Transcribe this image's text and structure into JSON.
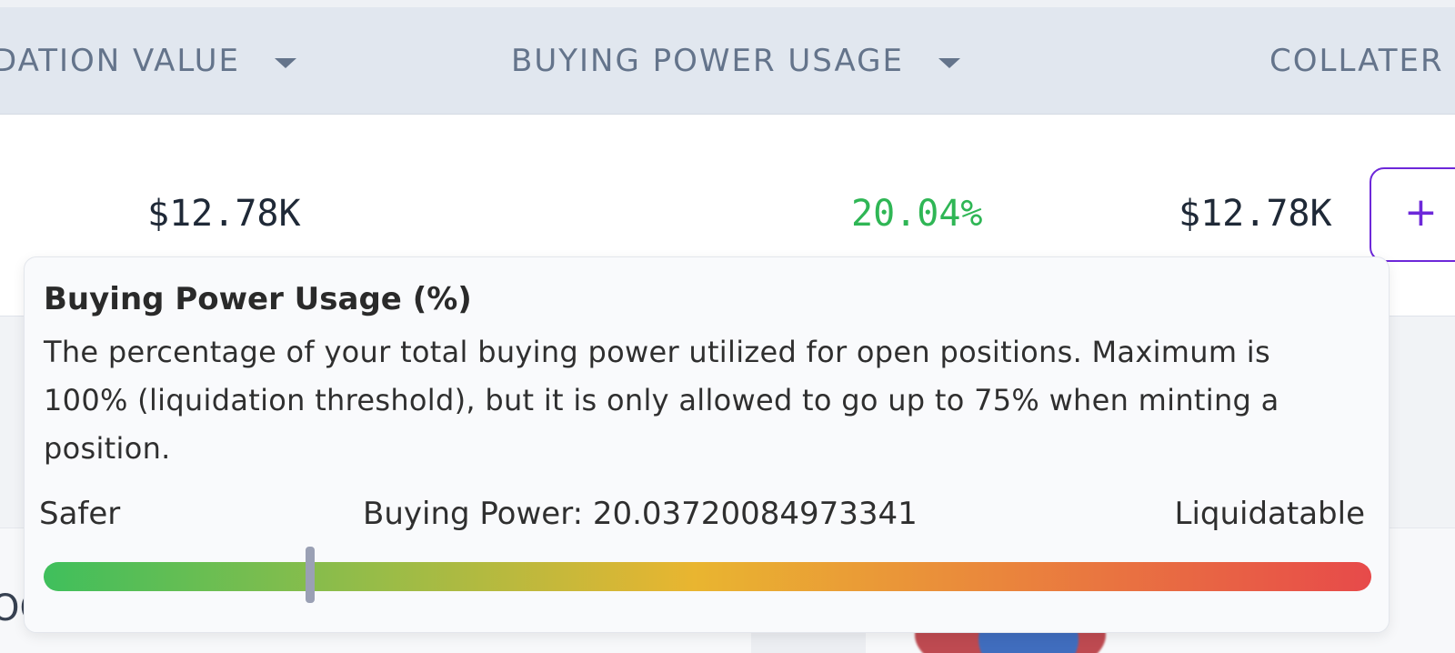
{
  "header": {
    "liquidation_value": "DATION VALUE",
    "buying_power_usage": "BUYING POWER USAGE",
    "collateral": "COLLATER"
  },
  "row": {
    "liquidation_value": "$12.78K",
    "buying_power_usage": "20.04%",
    "collateral": "$12.78K",
    "add_label": "+"
  },
  "colors": {
    "positive": "#2fb655",
    "accent": "#6d28d9",
    "header_bg": "#e1e7ef"
  },
  "lower": {
    "peek_text": "OC"
  },
  "tooltip": {
    "title": "Buying Power Usage (%)",
    "description": "The percentage of your total buying power utilized for open positions. Maximum is 100% (liquidation threshold), but it is only allowed to go up to 75% when minting a position.",
    "safer_label": "Safer",
    "buying_power_text": "Buying Power: 20.03720084973341",
    "liquidatable_label": "Liquidatable",
    "gauge_level": 0.2004
  }
}
